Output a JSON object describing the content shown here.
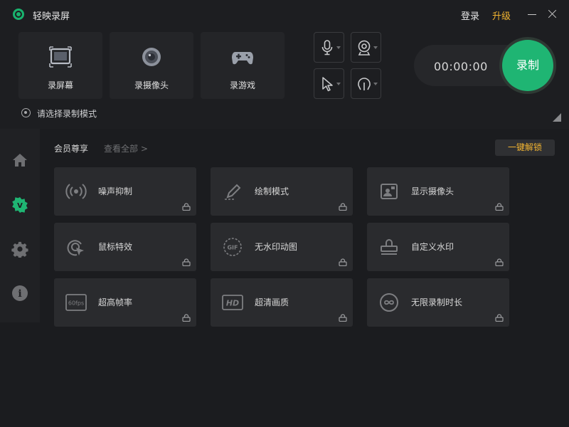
{
  "app": {
    "title": "轻映录屏"
  },
  "header": {
    "login_label": "登录",
    "upgrade_label": "升级"
  },
  "modes": [
    {
      "label": "录屏幕",
      "icon": "screen-icon"
    },
    {
      "label": "录摄像头",
      "icon": "webcam-icon"
    },
    {
      "label": "录游戏",
      "icon": "gamepad-icon"
    }
  ],
  "controls": {
    "microphone": "microphone-icon",
    "camera": "camera-icon",
    "cursor": "cursor-icon",
    "audio": "audio-output-icon"
  },
  "timer": {
    "value": "00:00:00"
  },
  "record": {
    "label": "录制"
  },
  "mode_hint": "请选择录制模式",
  "sidebar": [
    {
      "icon": "home-icon"
    },
    {
      "icon": "vip-icon",
      "badge": "V"
    },
    {
      "icon": "settings-icon"
    },
    {
      "icon": "info-icon",
      "badge": "i"
    }
  ],
  "vip": {
    "section_title": "会员尊享",
    "view_all": "查看全部 >",
    "unlock_label": "一键解锁",
    "features": [
      {
        "label": "噪声抑制",
        "icon": "noise-suppression-icon"
      },
      {
        "label": "绘制模式",
        "icon": "draw-mode-icon"
      },
      {
        "label": "显示摄像头",
        "icon": "show-camera-icon"
      },
      {
        "label": "鼠标特效",
        "icon": "mouse-effect-icon"
      },
      {
        "label": "无水印动图",
        "icon": "gif-icon",
        "icon_text": "GIF"
      },
      {
        "label": "自定义水印",
        "icon": "stamp-icon"
      },
      {
        "label": "超高帧率",
        "icon": "fps-icon",
        "icon_text": "60fps"
      },
      {
        "label": "超清画质",
        "icon": "hd-icon",
        "icon_text": "HD"
      },
      {
        "label": "无限录制时长",
        "icon": "infinite-icon"
      }
    ]
  },
  "colors": {
    "accent_green": "#1fb573",
    "accent_gold": "#f2b431",
    "background": "#1d1e21"
  }
}
